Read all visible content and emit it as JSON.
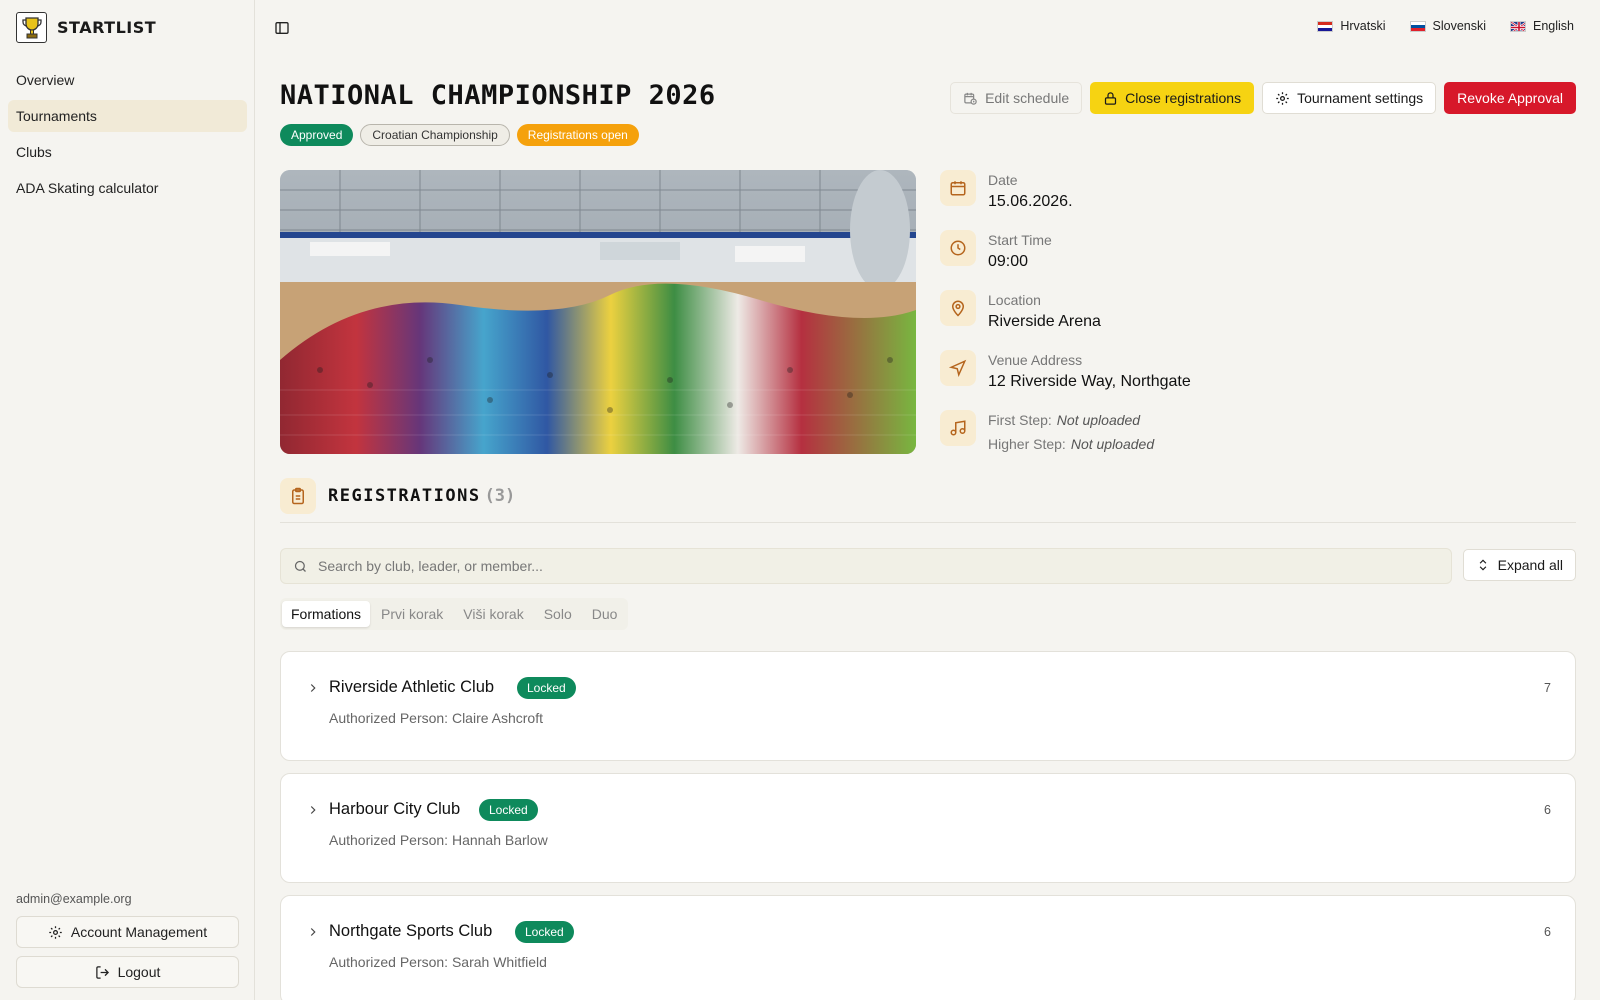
{
  "brand": {
    "name": "STARTLIST"
  },
  "nav": [
    {
      "label": "Overview",
      "active": false
    },
    {
      "label": "Tournaments",
      "active": true
    },
    {
      "label": "Clubs",
      "active": false
    },
    {
      "label": "ADA Skating calculator",
      "active": false
    }
  ],
  "account": {
    "email": "admin@example.org",
    "management_label": "Account Management",
    "logout_label": "Logout"
  },
  "languages": [
    {
      "label": "Hrvatski",
      "flag": "hr"
    },
    {
      "label": "Slovenski",
      "flag": "si"
    },
    {
      "label": "English",
      "flag": "gb"
    }
  ],
  "tournament": {
    "title": "NATIONAL CHAMPIONSHIP 2026",
    "badges": {
      "status": "Approved",
      "type": "Croatian Championship",
      "registration": "Registrations open"
    },
    "actions": {
      "edit_schedule": "Edit schedule",
      "close_registrations": "Close registrations",
      "settings": "Tournament settings",
      "revoke": "Revoke Approval"
    },
    "info": {
      "date_label": "Date",
      "date_value": "15.06.2026.",
      "time_label": "Start Time",
      "time_value": "09:00",
      "location_label": "Location",
      "location_value": "Riverside Arena",
      "address_label": "Venue Address",
      "address_value": "12 Riverside Way, Northgate",
      "first_step_label": "First Step:",
      "first_step_value": "Not uploaded",
      "higher_step_label": "Higher Step:",
      "higher_step_value": "Not uploaded"
    }
  },
  "registrations": {
    "title": "REGISTRATIONS",
    "count": "(3)",
    "search_placeholder": "Search by club, leader, or member...",
    "expand_label": "Expand all",
    "tabs": [
      {
        "label": "Formations",
        "active": true
      },
      {
        "label": "Prvi korak",
        "active": false
      },
      {
        "label": "Viši korak",
        "active": false
      },
      {
        "label": "Solo",
        "active": false
      },
      {
        "label": "Duo",
        "active": false
      }
    ],
    "clubs": [
      {
        "name": "Riverside Athletic Club",
        "badge": "Locked",
        "authorized": "Authorized Person: Claire Ashcroft",
        "count": "7"
      },
      {
        "name": "Harbour City Club",
        "badge": "Locked",
        "authorized": "Authorized Person: Hannah Barlow",
        "count": "6"
      },
      {
        "name": "Northgate Sports Club",
        "badge": "Locked",
        "authorized": "Authorized Person: Sarah Whitfield",
        "count": "6"
      }
    ]
  },
  "colors": {
    "accent_yellow": "#f6d312",
    "approved_green": "#0e8a5c",
    "open_orange": "#f5a10c",
    "revoke_red": "#d7182a",
    "icon_brown": "#b5651d"
  }
}
